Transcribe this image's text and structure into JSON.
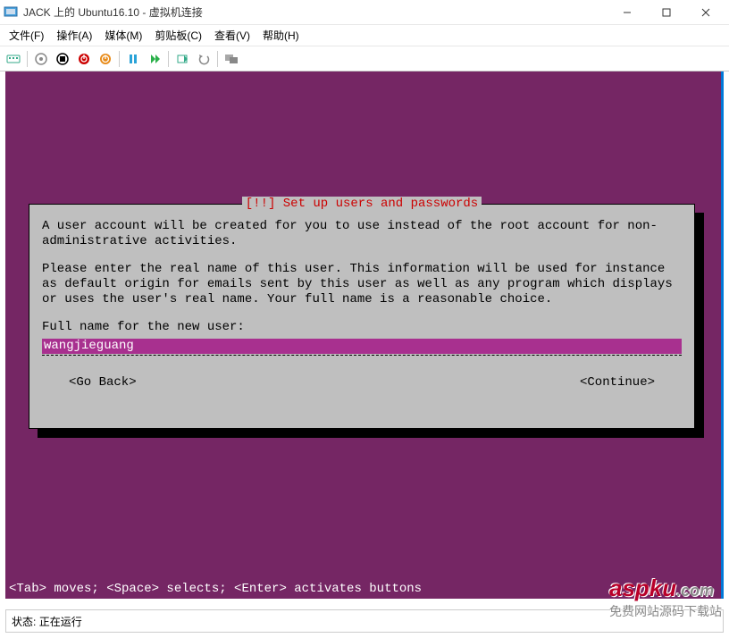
{
  "window": {
    "title": "JACK 上的 Ubuntu16.10 - 虚拟机连接"
  },
  "menu": {
    "file": "文件(F)",
    "action": "操作(A)",
    "media": "媒体(M)",
    "clipboard": "剪贴板(C)",
    "view": "查看(V)",
    "help": "帮助(H)"
  },
  "installer": {
    "title": "[!!] Set up users and passwords",
    "paragraph1": "A user account will be created for you to use instead of the root account for non-administrative activities.",
    "paragraph2": "Please enter the real name of this user. This information will be used for instance as default origin for emails sent by this user as well as any program which displays or uses the user's real name. Your full name is a reasonable choice.",
    "prompt": "Full name for the new user:",
    "input_value": "wangjieguang",
    "go_back": "<Go Back>",
    "continue": "<Continue>",
    "help_line": "<Tab> moves; <Space> selects; <Enter> activates buttons"
  },
  "status": {
    "label": "状态:",
    "value": "正在运行"
  },
  "watermark": {
    "main": "aspku",
    "tld": ".com",
    "sub": "免费网站源码下载站"
  }
}
